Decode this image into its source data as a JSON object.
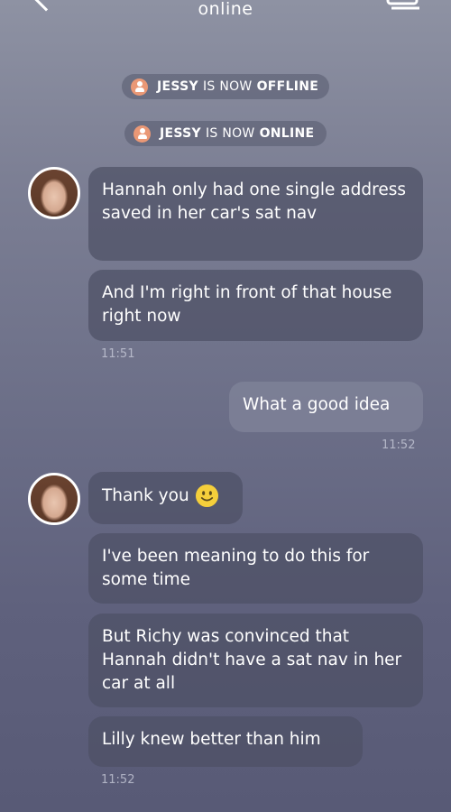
{
  "header": {
    "status": "online"
  },
  "notices": [
    {
      "name": "JESSY",
      "mid": "IS NOW",
      "state": "OFFLINE"
    },
    {
      "name": "JESSY",
      "mid": "IS NOW",
      "state": "ONLINE"
    }
  ],
  "messages": [
    {
      "text": "Hannah only had one single address saved in her car's sat nav"
    },
    {
      "text": "And I'm right in front of that house right now"
    },
    {
      "text": "What a good idea"
    },
    {
      "text": "Thank you"
    },
    {
      "text": "I've been meaning to do this for some time"
    },
    {
      "text": "But Richy was convinced that Hannah didn't have a sat nav in her car at all"
    },
    {
      "text": "Lilly knew better than him"
    }
  ],
  "timestamps": [
    "11:51",
    "11:52",
    "11:52"
  ],
  "icons": {
    "back": "chevron-left-icon",
    "gallery": "gallery-icon",
    "notice": "user-badge-icon",
    "emoji": "smiling-face-emoji"
  },
  "colors": {
    "notice_icon": "#ea9876",
    "emoji": "#f5cf3b"
  }
}
